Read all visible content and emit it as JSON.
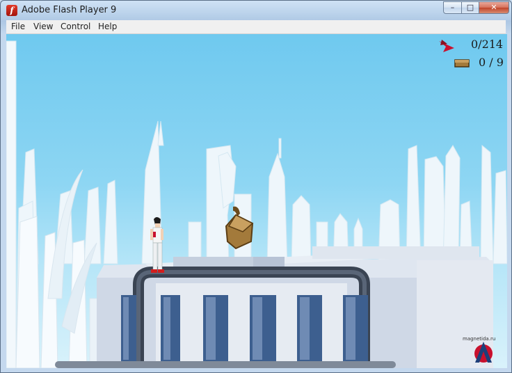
{
  "window": {
    "title": "Adobe Flash Player 9",
    "controls": {
      "minimize": "–",
      "maximize": "□",
      "close": "✕"
    }
  },
  "menu": [
    "File",
    "View",
    "Control",
    "Help"
  ],
  "hud": {
    "runner_count": "0/214",
    "bag_count": "0 / 9",
    "runner_icon": "runner-logo-icon",
    "bag_icon": "bag-icon"
  },
  "watermark": {
    "text": "magnetida.ru",
    "logo_letter": "A"
  },
  "colors": {
    "sky_top": "#6fc9ef",
    "accent_red": "#c8102e",
    "rooftop": "#cdd7e6"
  }
}
